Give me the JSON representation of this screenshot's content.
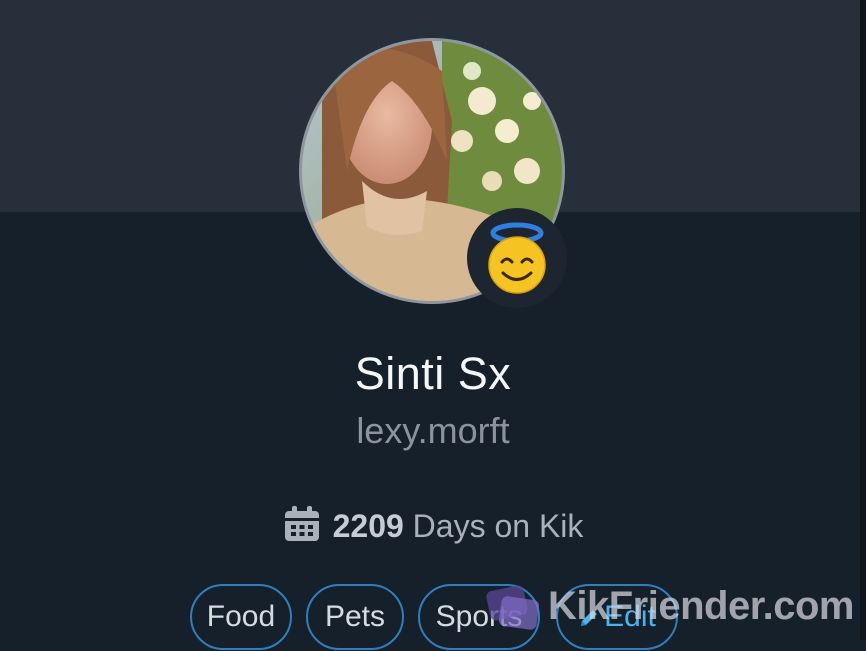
{
  "profile": {
    "display_name": "Sinti Sx",
    "username": "lexy.morft",
    "status_emoji": "smiling-face-with-halo"
  },
  "stats": {
    "days_count": "2209",
    "days_label": " Days on Kik"
  },
  "interests": [
    "Food",
    "Pets",
    "Sports"
  ],
  "edit_label": "Edit",
  "watermark": "KikFriender.com",
  "colors": {
    "background": "#16202b",
    "header_band": "#262f3a",
    "chip_border": "#2f7fbf",
    "edit_accent": "#4ab3f2"
  }
}
